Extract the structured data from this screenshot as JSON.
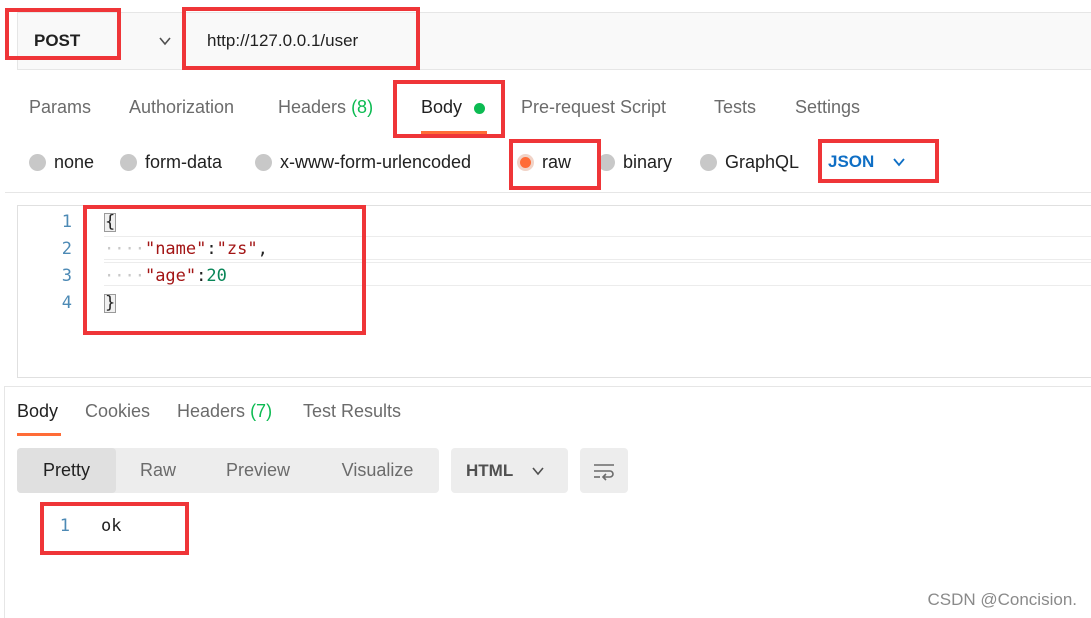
{
  "request": {
    "method": "POST",
    "url": "http://127.0.0.1/user"
  },
  "request_tabs": [
    {
      "label": "Params"
    },
    {
      "label": "Authorization"
    },
    {
      "label": "Headers",
      "count": "(8)"
    },
    {
      "label": "Body",
      "active": true
    },
    {
      "label": "Pre-request Script"
    },
    {
      "label": "Tests"
    },
    {
      "label": "Settings"
    }
  ],
  "body_types": [
    {
      "label": "none"
    },
    {
      "label": "form-data"
    },
    {
      "label": "x-www-form-urlencoded"
    },
    {
      "label": "raw",
      "selected": true
    },
    {
      "label": "binary"
    },
    {
      "label": "GraphQL"
    }
  ],
  "raw_format": "JSON",
  "editor": {
    "line_numbers": [
      "1",
      "2",
      "3",
      "4"
    ],
    "open_brace": "{",
    "close_brace": "}",
    "indent": "····",
    "name_key": "\"name\"",
    "name_value": "\"zs\"",
    "age_key": "\"age\"",
    "age_value": "20",
    "colon": ":",
    "comma": ","
  },
  "response_tabs": [
    {
      "label": "Body",
      "active": true
    },
    {
      "label": "Cookies"
    },
    {
      "label": "Headers",
      "count": "(7)"
    },
    {
      "label": "Test Results"
    }
  ],
  "view_modes": [
    {
      "label": "Pretty",
      "active": true
    },
    {
      "label": "Raw"
    },
    {
      "label": "Preview"
    },
    {
      "label": "Visualize"
    }
  ],
  "response_format": "HTML",
  "response": {
    "line_number": "1",
    "text": "ok"
  },
  "watermark": "CSDN @Concision.",
  "colors": {
    "accent": "#ff6c37",
    "status_green": "#0cbb52",
    "link_blue": "#0f6fc5",
    "annotation_red": "#ef3538"
  },
  "icons": [
    "chevron-down-icon",
    "status-dot-icon",
    "radio-icon",
    "wrap-lines-icon"
  ]
}
